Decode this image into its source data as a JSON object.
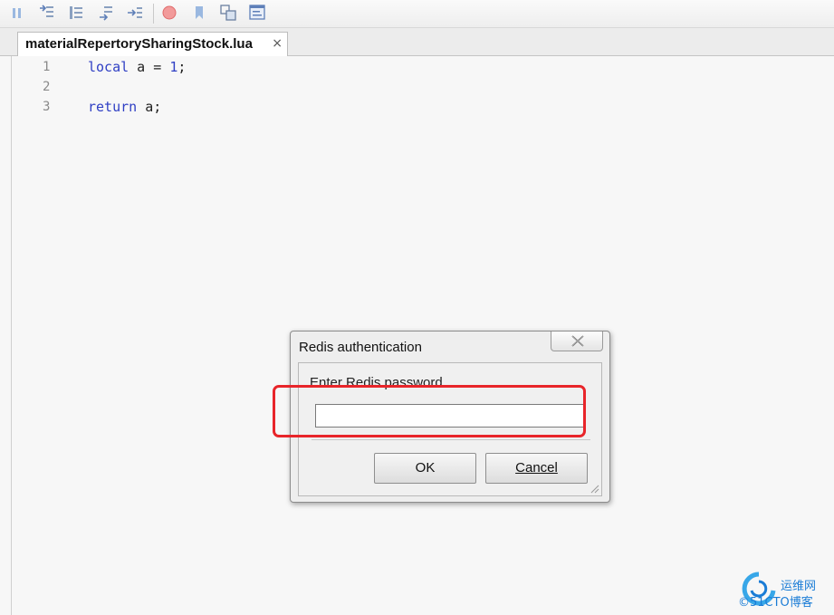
{
  "toolbar": {
    "buttons": [
      {
        "name": "pause-icon"
      },
      {
        "name": "step-into-icon"
      },
      {
        "name": "step-over-icon"
      },
      {
        "name": "step-out-icon"
      },
      {
        "name": "run-to-cursor-icon"
      },
      {
        "name": "breakpoint-icon"
      },
      {
        "name": "bookmark-icon"
      },
      {
        "name": "variables-icon"
      },
      {
        "name": "console-icon"
      }
    ]
  },
  "tab": {
    "title": "materialRepertorySharingStock.lua",
    "close_glyph": "×"
  },
  "editor": {
    "lines": [
      {
        "number": "1",
        "tokens": [
          {
            "text": "local",
            "kind": "kw"
          },
          {
            "text": " a = ",
            "kind": "plain"
          },
          {
            "text": "1",
            "kind": "num"
          },
          {
            "text": ";",
            "kind": "plain"
          }
        ]
      },
      {
        "number": "2",
        "tokens": []
      },
      {
        "number": "3",
        "tokens": [
          {
            "text": "return",
            "kind": "kw"
          },
          {
            "text": " a;",
            "kind": "plain"
          }
        ]
      }
    ]
  },
  "dialog": {
    "title": "Redis authentication",
    "prompt": "Enter Redis password",
    "password_value": "",
    "ok_label": "OK",
    "cancel_label": "Cancel"
  },
  "watermark": {
    "site": "运维网",
    "domain": "©51CTO博客"
  },
  "colors": {
    "keyword": "#2f3fc4",
    "annotation": "#e8252a",
    "watermark": "#1a7cd6"
  }
}
